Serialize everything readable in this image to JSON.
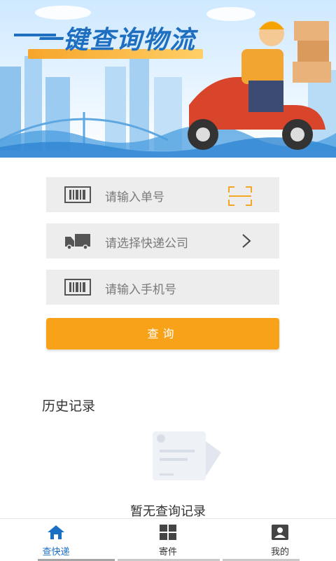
{
  "banner": {
    "title": "一键查询物流"
  },
  "form": {
    "tracking_placeholder": "请输入单号",
    "company_placeholder": "请选择快递公司",
    "phone_placeholder": "请输入手机号",
    "submit_label": "查询"
  },
  "history": {
    "title": "历史记录",
    "empty_text": "暂无查询记录"
  },
  "nav": {
    "items": [
      {
        "label": "查快递",
        "icon": "home-icon",
        "active": true
      },
      {
        "label": "寄件",
        "icon": "grid-icon",
        "active": false
      },
      {
        "label": "我的",
        "icon": "profile-icon",
        "active": false
      }
    ]
  },
  "colors": {
    "accent": "#F8A21A",
    "primary": "#1A6FC4",
    "input_bg": "#EDEDED"
  }
}
